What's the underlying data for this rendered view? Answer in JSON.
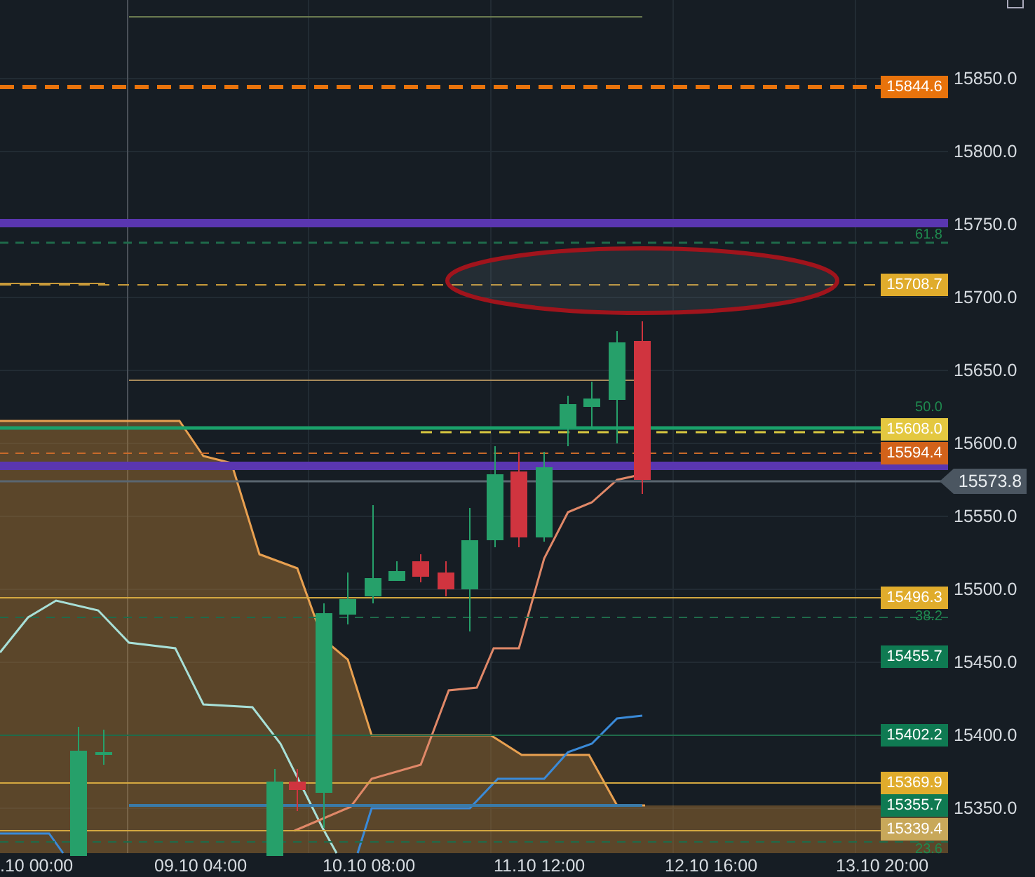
{
  "price_axis": {
    "ticks": [
      "15850.0",
      "15800.0",
      "15750.0",
      "15700.0",
      "15650.0",
      "15600.0",
      "15550.0",
      "15500.0",
      "15450.0",
      "15400.0",
      "15350.0"
    ]
  },
  "time_axis": {
    "ticks": [
      ".10 00:00",
      "09.10 04:00",
      "10.10 08:00",
      "11.10 12:00",
      "12.10 16:00",
      "13.10 20:00"
    ]
  },
  "price_tags": [
    {
      "text": "15844.6",
      "color": "#e8730c",
      "kind": "tag"
    },
    {
      "text": "15708.7",
      "color": "#e0ac2c",
      "kind": "tag"
    },
    {
      "text": "15608.0",
      "color": "#e4c840",
      "kind": "tag"
    },
    {
      "text": "15594.4",
      "color": "#d2621a",
      "kind": "tag"
    },
    {
      "text": "15573.8",
      "color": "#4b5661",
      "kind": "current"
    },
    {
      "text": "15496.3",
      "color": "#e0ac2c",
      "kind": "tag"
    },
    {
      "text": "15455.7",
      "color": "#0f7a52",
      "kind": "tag"
    },
    {
      "text": "15402.2",
      "color": "#0f7a52",
      "kind": "tag"
    },
    {
      "text": "15369.9",
      "color": "#e0ac2c",
      "kind": "tag"
    },
    {
      "text": "15355.7",
      "color": "#0f7a52",
      "kind": "tag"
    },
    {
      "text": "15339.4",
      "color": "#c8a85a",
      "kind": "tag"
    }
  ],
  "fib_levels": [
    "61.8",
    "50.0",
    "38.2",
    "23.6"
  ]
}
